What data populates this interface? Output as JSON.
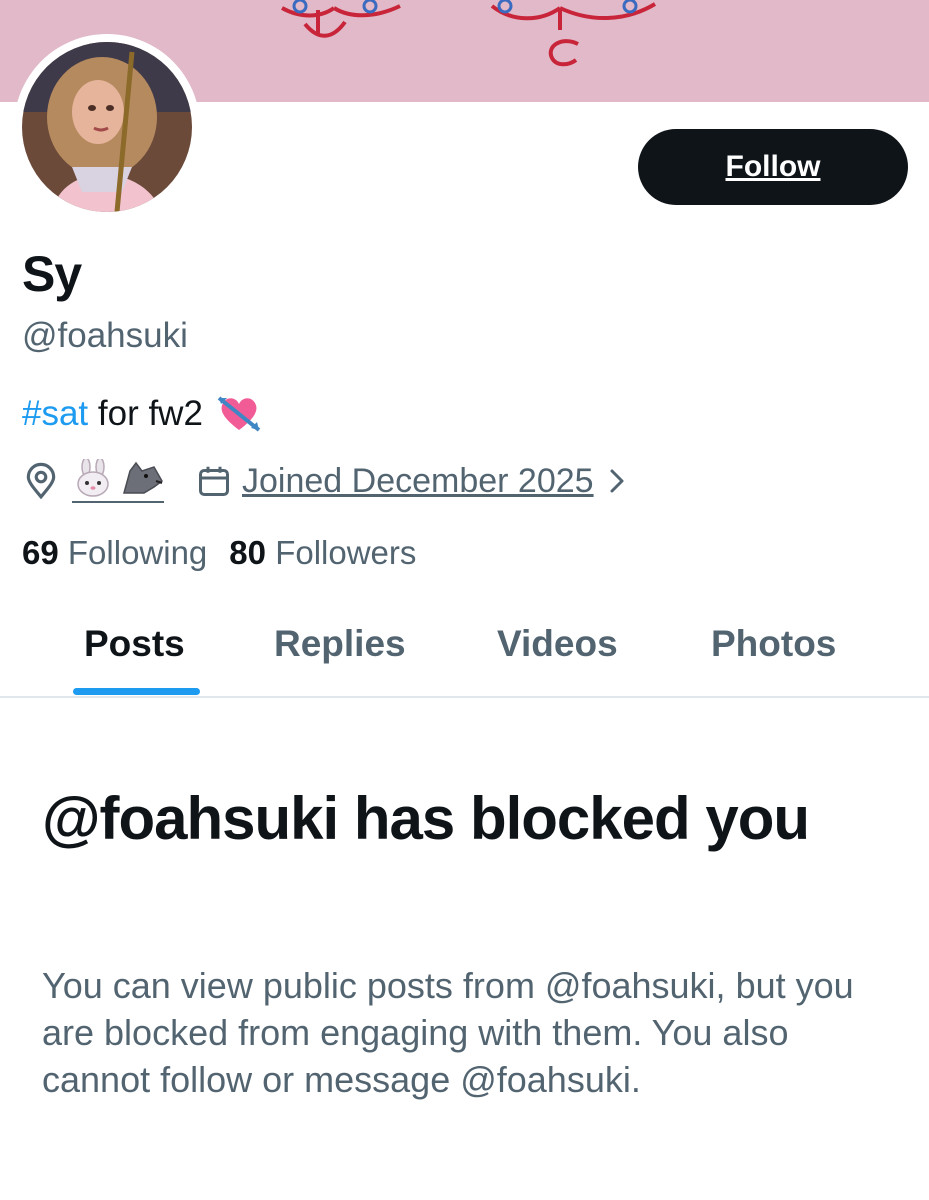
{
  "banner": {
    "color": "#e2b9c8",
    "art_color": "#c8253a",
    "ornament_color": "#3a6bc0"
  },
  "profile": {
    "display_name": "Sy",
    "handle": "@foahsuki",
    "bio": {
      "hashtag": "#sat",
      "text": " for fw2",
      "emoji": "heart-with-arrow"
    },
    "location_emoji": [
      "rabbit-face",
      "wolf"
    ],
    "joined": "Joined December 2025",
    "following_count": "69",
    "following_label": "Following",
    "followers_count": "80",
    "followers_label": "Followers"
  },
  "actions": {
    "follow_label": "Follow"
  },
  "tabs": [
    {
      "label": "Posts",
      "active": true
    },
    {
      "label": "Replies",
      "active": false
    },
    {
      "label": "Videos",
      "active": false
    },
    {
      "label": "Photos",
      "active": false
    }
  ],
  "blocked": {
    "title": "@foahsuki has blocked you",
    "body": "You can view public posts from @foahsuki, but you are blocked from engaging with them. You also cannot follow or message @foahsuki."
  },
  "colors": {
    "text_primary": "#0f1419",
    "text_secondary": "#536471",
    "accent": "#1d9bf0",
    "button_bg": "#0f1419",
    "divider": "#e1e8ed"
  },
  "icons": {
    "location": "location-pin-icon",
    "calendar": "calendar-icon",
    "chevron": "chevron-right-icon"
  }
}
